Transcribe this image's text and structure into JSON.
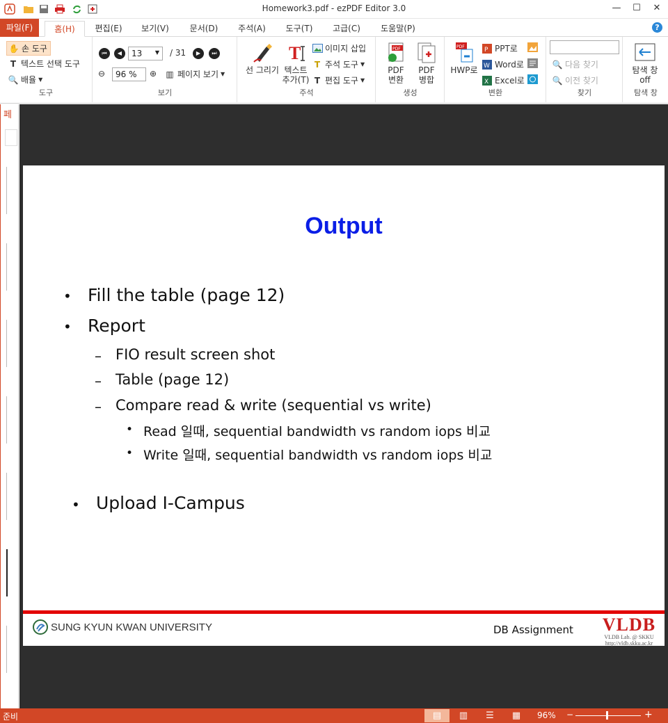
{
  "app": {
    "title": "Homework3.pdf - ezPDF Editor 3.0"
  },
  "menu_tabs": [
    {
      "label": "파일(F)"
    },
    {
      "label": "홈(H)"
    },
    {
      "label": "편집(E)"
    },
    {
      "label": "보기(V)"
    },
    {
      "label": "문서(D)"
    },
    {
      "label": "주석(A)"
    },
    {
      "label": "도구(T)"
    },
    {
      "label": "고급(C)"
    },
    {
      "label": "도움말(P)"
    }
  ],
  "ribbon": {
    "tools": {
      "label": "도구",
      "hand": "손 도구",
      "text_select": "텍스트 선택 도구",
      "zoom": "배율"
    },
    "view": {
      "label": "보기",
      "page_current": "13",
      "page_total": "/ 31",
      "zoom_value": "96 %",
      "page_view": "페이지 보기"
    },
    "annotation": {
      "label": "주석",
      "draw_line": "선 그리기",
      "add_text_1": "텍스트",
      "add_text_2": "추가(T)",
      "insert_image": "이미지 삽입",
      "annot_tool": "주석 도구",
      "edit_tool": "편집 도구"
    },
    "create": {
      "label": "생성",
      "pdf_convert_1": "PDF",
      "pdf_convert_2": "변환",
      "pdf_merge_1": "PDF",
      "pdf_merge_2": "병합"
    },
    "convert": {
      "label": "변환",
      "hwp": "HWP로",
      "ppt": "PPT로",
      "word": "Word로",
      "excel": "Excel로"
    },
    "find": {
      "label": "찾기",
      "next": "다음 찾기",
      "prev": "이전 찾기",
      "search_value": ""
    },
    "nav_pane": {
      "label": "탐색 창",
      "btn_1": "탐색 창",
      "btn_2": "off"
    }
  },
  "left_panel": {
    "tab_label": "페"
  },
  "slide": {
    "title": "Output",
    "bullets": [
      "Fill the table (page 12)",
      "Report",
      "Upload I-Campus"
    ],
    "report_subitems": [
      "FIO result screen shot",
      "Table (page 12)",
      "Compare read & write (sequential vs write)"
    ],
    "compare_subitems": [
      "Read 일때, sequential bandwidth vs random iops 비교",
      "Write 일때, sequential bandwidth vs random iops 비교"
    ],
    "footer": {
      "university": "SUNG KYUN KWAN UNIVERSITY",
      "course": "DB Assignment",
      "lab_logo": "VLDB",
      "lab_sub1": "VLDB Lab. @ SKKU",
      "lab_sub2": "http://vldb.skku.ac.kr"
    }
  },
  "status": {
    "text": "준비",
    "zoom": "96%",
    "zoom_fraction": 0.48
  },
  "colors": {
    "accent": "#d24726",
    "slide_title": "#0a1ee6",
    "slide_rule": "#e30000"
  }
}
